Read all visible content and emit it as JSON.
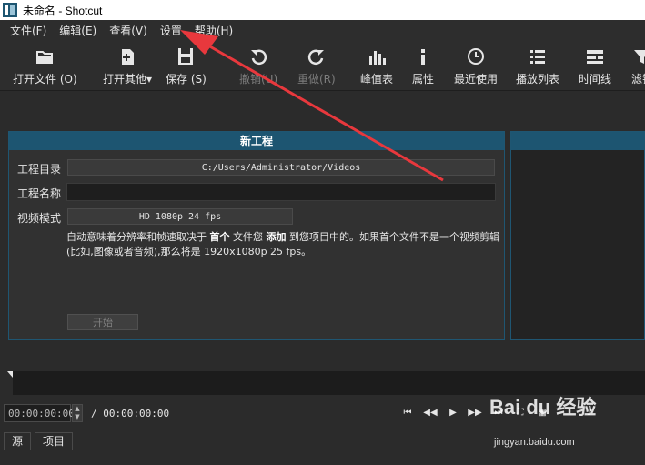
{
  "window": {
    "title": "未命名 - Shotcut"
  },
  "menu": [
    {
      "label": "文件(F)"
    },
    {
      "label": "编辑(E)"
    },
    {
      "label": "查看(V)"
    },
    {
      "label": "设置"
    },
    {
      "label": "帮助(H)"
    }
  ],
  "toolbar": {
    "open_file": "打开文件 (O)",
    "open_other": "打开其他",
    "save": "保存 (S)",
    "undo": "撤销(U)",
    "redo": "重做(R)",
    "peak_meter": "峰值表",
    "properties": "属性",
    "recent": "最近使用",
    "playlist": "播放列表",
    "timeline": "时间线",
    "filters": "滤镜"
  },
  "new_project": {
    "header": "新工程",
    "dir_label": "工程目录",
    "dir_value": "C:/Users/Administrator/Videos",
    "name_label": "工程名称",
    "name_value": "",
    "mode_label": "视频模式",
    "mode_value": "HD 1080p 24 fps",
    "desc_part1": "自动意味着分辨率和帧速取决于 ",
    "desc_bold1": "首个",
    "desc_part2": " 文件您 ",
    "desc_bold2": "添加",
    "desc_part3": " 到您项目中的。如果首个文件不是一个视频剪辑(比如,图像或者音频),那么将是 1920x1080p 25 fps。",
    "start_button": "开始"
  },
  "transport": {
    "position": "00:00:00:00",
    "duration": "/ 00:00:00:00"
  },
  "tabs": [
    {
      "label": "源"
    },
    {
      "label": "项目"
    }
  ],
  "watermark": {
    "logo": "Bai du 经验",
    "url": "jingyan.baidu.com"
  },
  "colors": {
    "accent": "#1d5571",
    "arrow": "#e8383d"
  }
}
